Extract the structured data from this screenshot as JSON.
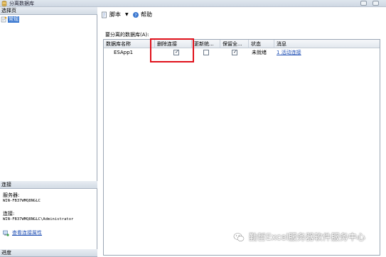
{
  "window": {
    "title": "分离数据库"
  },
  "left_pane": {
    "pages_header": "选择页",
    "pages": [
      {
        "label": "常规"
      }
    ],
    "connection_header": "连接",
    "server_label": "服务器:",
    "server_value": "WIN-FB37WMQ8NGLC",
    "connection_label": "连接:",
    "connection_value": "WIN-FB37WMQ8NGLC\\Administrator",
    "view_connection_link": "查看连接属性",
    "progress_header": "进度"
  },
  "toolbar": {
    "script_label": "脚本",
    "help_label": "帮助"
  },
  "main": {
    "section_title": "要分离的数据库(A):",
    "columns": [
      "数据库名称",
      "删除连接",
      "更新统...",
      "保留全...",
      "状态",
      "消息"
    ],
    "rows": [
      {
        "name": "ESApp1",
        "drop_connections": true,
        "update_stats": false,
        "keep_fulltext": true,
        "status": "未就绪",
        "message": "1 活动连接"
      }
    ]
  },
  "watermark": {
    "text": "勤哲Excel服务器软件服务中心"
  }
}
